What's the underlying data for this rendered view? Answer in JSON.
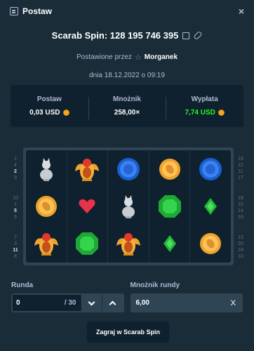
{
  "header": {
    "title": "Postaw",
    "close_label": "×"
  },
  "bet": {
    "id_text": "Scarab Spin: 128 195 746 395",
    "placed_by_prefix": "Postawione przez",
    "username": "Morganek",
    "date": "dnia 18.12.2022 o 09:19"
  },
  "stats": [
    {
      "label": "Postaw",
      "value": "0,03 USD",
      "coin": true,
      "color": "#ffffff"
    },
    {
      "label": "Mnożnik",
      "value": "258,00×",
      "coin": false,
      "color": "#ffffff"
    },
    {
      "label": "Wypłata",
      "value": "7,74 USD",
      "coin": true,
      "color": "#1fff20"
    }
  ],
  "reels": [
    [
      "cat",
      "coin",
      "scarab"
    ],
    [
      "scarab",
      "heart",
      "emerald"
    ],
    [
      "sapphire",
      "cat",
      "scarab"
    ],
    [
      "coin",
      "emerald",
      "small-emerald"
    ],
    [
      "sapphire",
      "small-emerald",
      "coin"
    ]
  ],
  "side_numbers": {
    "left": [
      [
        "1",
        "4",
        "2",
        "9"
      ],
      [
        "10",
        "1",
        "5",
        "6"
      ],
      [
        "7",
        "3",
        "11",
        "8"
      ]
    ],
    "right": [
      [
        "19",
        "12",
        "11",
        "17"
      ],
      [
        "18",
        "15",
        "14",
        "16"
      ],
      [
        "13",
        "20",
        "18",
        "10"
      ]
    ]
  },
  "round": {
    "label": "Runda",
    "value": "0",
    "suffix": "/ 30"
  },
  "round_multiplier": {
    "label": "Mnożnik rundy",
    "value": "6,00",
    "clear": "X"
  },
  "spin_button": "Zagraj w Scarab Spin"
}
